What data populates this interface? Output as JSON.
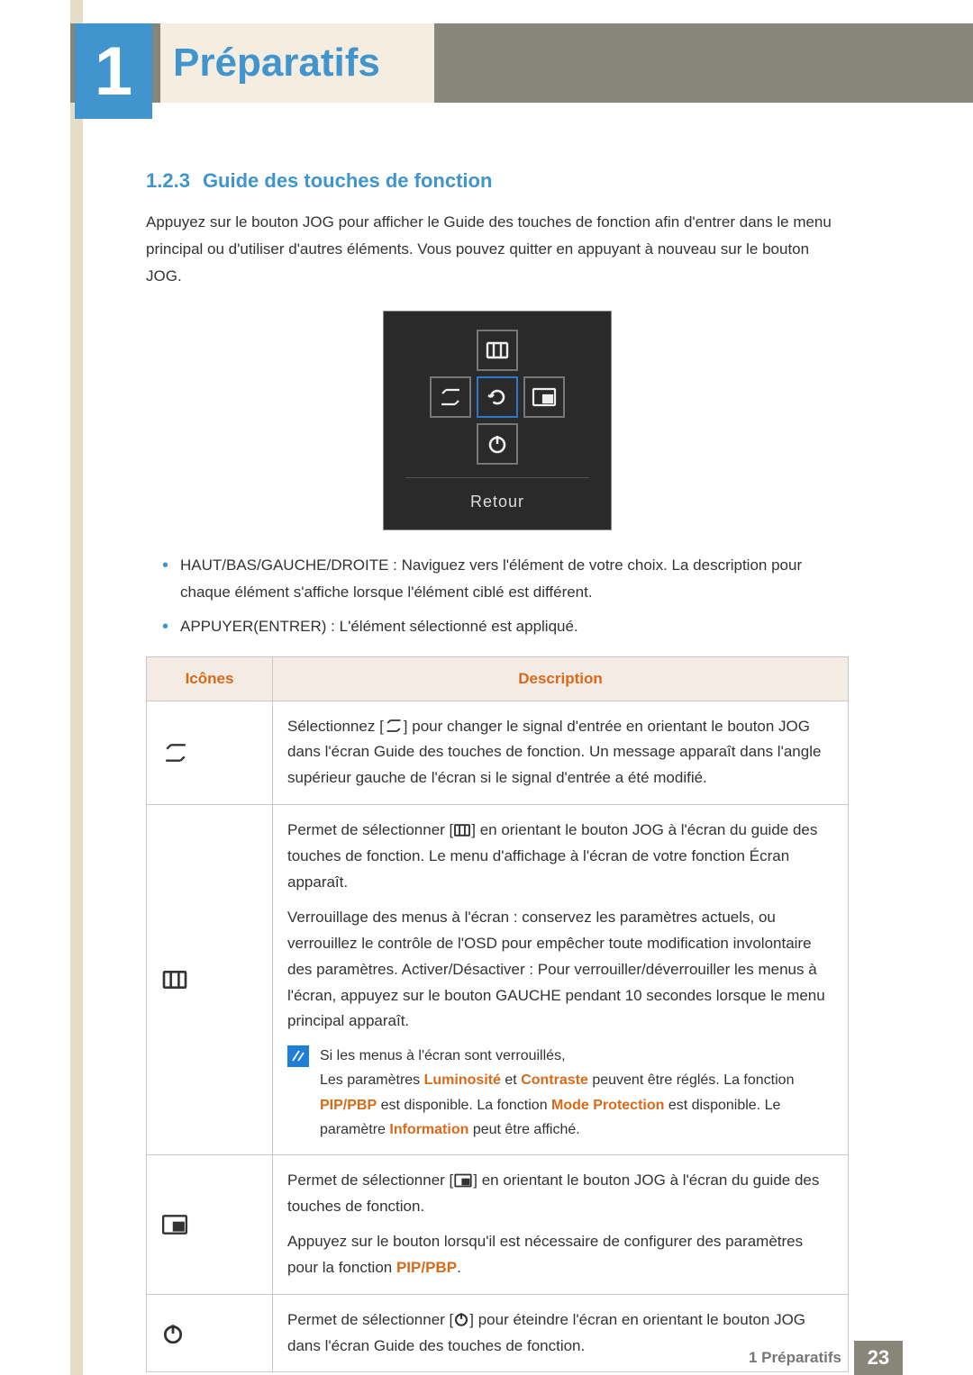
{
  "chapter": {
    "number": "1",
    "title": "Préparatifs"
  },
  "section": {
    "number": "1.2.3",
    "title": "Guide des touches de fonction"
  },
  "intro": "Appuyez sur le bouton JOG pour afficher le Guide des touches de fonction afin d'entrer dans le menu principal ou d'utiliser d'autres éléments. Vous pouvez quitter en appuyant à nouveau sur le bouton JOG.",
  "osd": {
    "return_label": "Retour"
  },
  "nav_list": [
    "HAUT/BAS/GAUCHE/DROITE : Naviguez vers l'élément de votre choix. La description pour chaque élément s'affiche lorsque l'élément ciblé est différent.",
    "APPUYER(ENTRER) : L'élément sélectionné est appliqué."
  ],
  "table": {
    "headers": {
      "icons": "Icônes",
      "desc": "Description"
    },
    "rows": {
      "source": {
        "icon": "source-icon",
        "desc_pre": "Sélectionnez [",
        "desc_post": "] pour changer le signal d'entrée en orientant le bouton JOG dans l'écran Guide des touches de fonction. Un message apparaît dans l'angle supérieur gauche de l'écran si le signal d'entrée a été modifié."
      },
      "menu": {
        "icon": "menu-icon",
        "p1_pre": "Permet de sélectionner [",
        "p1_post": "] en orientant le bouton JOG à l'écran du guide des touches de fonction. Le menu d'affichage à l'écran de votre fonction Écran apparaît.",
        "p2": "Verrouillage des menus à l'écran : conservez les paramètres actuels, ou verrouillez le contrôle de l'OSD pour empêcher toute modification involontaire des paramètres. Activer/Désactiver : Pour verrouiller/déverrouiller les menus à l'écran, appuyez sur le bouton GAUCHE pendant 10 secondes lorsque le menu principal apparaît.",
        "note_intro": "Si les menus à l'écran sont verrouillés,",
        "note_l1a": "Les paramètres ",
        "note_lum": "Luminosité",
        "note_et": " et ",
        "note_con": "Contraste",
        "note_l1b": " peuvent être réglés. La fonction ",
        "note_pip": "PIP/PBP",
        "note_l2a": " est disponible. La fonction ",
        "note_mode": "Mode Protection",
        "note_l2b": " est disponible. Le paramètre ",
        "note_info": "Information",
        "note_l3": " peut être affiché."
      },
      "pip": {
        "icon": "pip-icon",
        "p1_pre": "Permet de sélectionner [",
        "p1_post": "] en orientant le bouton JOG à l'écran du guide des touches de fonction.",
        "p2a": "Appuyez sur le bouton lorsqu'il est nécessaire de configurer des paramètres pour la fonction ",
        "p2_pip": "PIP/PBP",
        "p2b": "."
      },
      "power": {
        "icon": "power-icon",
        "desc_pre": "Permet de sélectionner [",
        "desc_post": "] pour éteindre l'écran en orientant le bouton JOG dans l'écran Guide des touches de fonction."
      }
    }
  },
  "footer": {
    "label": "1 Préparatifs",
    "page": "23"
  }
}
